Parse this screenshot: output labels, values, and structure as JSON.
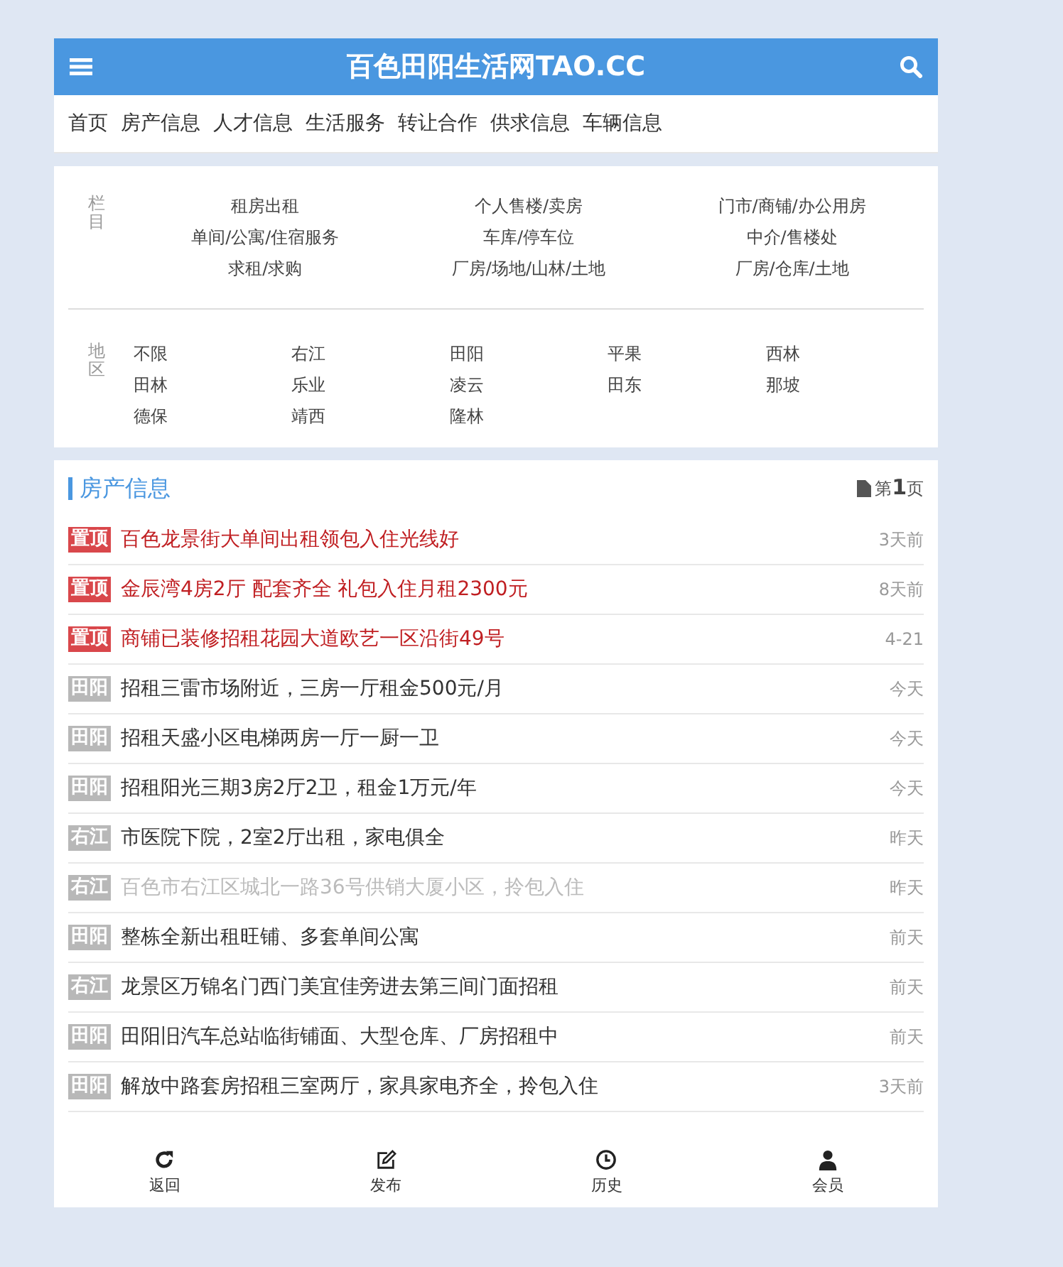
{
  "header": {
    "title": "百色田阳生活网TAO.CC"
  },
  "nav": [
    {
      "label": "首页"
    },
    {
      "label": "房产信息"
    },
    {
      "label": "人才信息"
    },
    {
      "label": "生活服务"
    },
    {
      "label": "转让合作"
    },
    {
      "label": "供求信息"
    },
    {
      "label": "车辆信息"
    }
  ],
  "filters": {
    "category_label": "栏目",
    "categories": [
      "租房出租",
      "个人售楼/卖房",
      "门市/商铺/办公用房",
      "单间/公寓/住宿服务",
      "车库/停车位",
      "中介/售楼处",
      "求租/求购",
      "厂房/场地/山林/土地",
      "厂房/仓库/土地"
    ],
    "region_label": "地区",
    "regions": [
      "不限",
      "右江",
      "田阳",
      "平果",
      "西林",
      "田林",
      "乐业",
      "凌云",
      "田东",
      "那坡",
      "德保",
      "靖西",
      "隆林"
    ]
  },
  "section": {
    "title": "房产信息",
    "page_prefix": "第",
    "page_number": "1",
    "page_suffix": "页"
  },
  "listings": [
    {
      "tag": "置顶",
      "color": "#d9474b",
      "kind": "top",
      "title": "百色龙景街大单间出租领包入住光线好",
      "time": "3天前"
    },
    {
      "tag": "置顶",
      "color": "#d9474b",
      "kind": "top",
      "title": "金辰湾4房2厅 配套齐全 礼包入住月租2300元",
      "time": "8天前"
    },
    {
      "tag": "置顶",
      "color": "#d9474b",
      "kind": "top",
      "title": "商铺已装修招租花园大道欧艺一区沿街49号",
      "time": "4-21"
    },
    {
      "tag": "田阳",
      "color": "#b8b8b8",
      "kind": "normal",
      "title": "招租三雷市场附近，三房一厅租金500元/月",
      "time": "今天"
    },
    {
      "tag": "田阳",
      "color": "#b8b8b8",
      "kind": "normal",
      "title": "招租天盛小区电梯两房一厅一厨一卫",
      "time": "今天"
    },
    {
      "tag": "田阳",
      "color": "#b8b8b8",
      "kind": "normal",
      "title": "招租阳光三期3房2厅2卫，租金1万元/年",
      "time": "今天"
    },
    {
      "tag": "右江",
      "color": "#b8b8b8",
      "kind": "normal",
      "title": "市医院下院，2室2厅出租，家电俱全",
      "time": "昨天"
    },
    {
      "tag": "右江",
      "color": "#b8b8b8",
      "kind": "dim",
      "title": "百色市右江区城北一路36号供销大厦小区，拎包入住",
      "time": "昨天"
    },
    {
      "tag": "田阳",
      "color": "#b8b8b8",
      "kind": "normal",
      "title": "整栋全新出租旺铺、多套单间公寓",
      "time": "前天"
    },
    {
      "tag": "右江",
      "color": "#b8b8b8",
      "kind": "normal",
      "title": "龙景区万锦名门西门美宜佳旁进去第三间门面招租",
      "time": "前天"
    },
    {
      "tag": "田阳",
      "color": "#b8b8b8",
      "kind": "normal",
      "title": "田阳旧汽车总站临街铺面、大型仓库、厂房招租中",
      "time": "前天"
    },
    {
      "tag": "田阳",
      "color": "#b8b8b8",
      "kind": "normal",
      "title": "解放中路套房招租三室两厅，家具家电齐全，拎包入住",
      "time": "3天前"
    }
  ],
  "bottom_nav": [
    {
      "label": "返回"
    },
    {
      "label": "发布"
    },
    {
      "label": "历史"
    },
    {
      "label": "会员"
    }
  ]
}
